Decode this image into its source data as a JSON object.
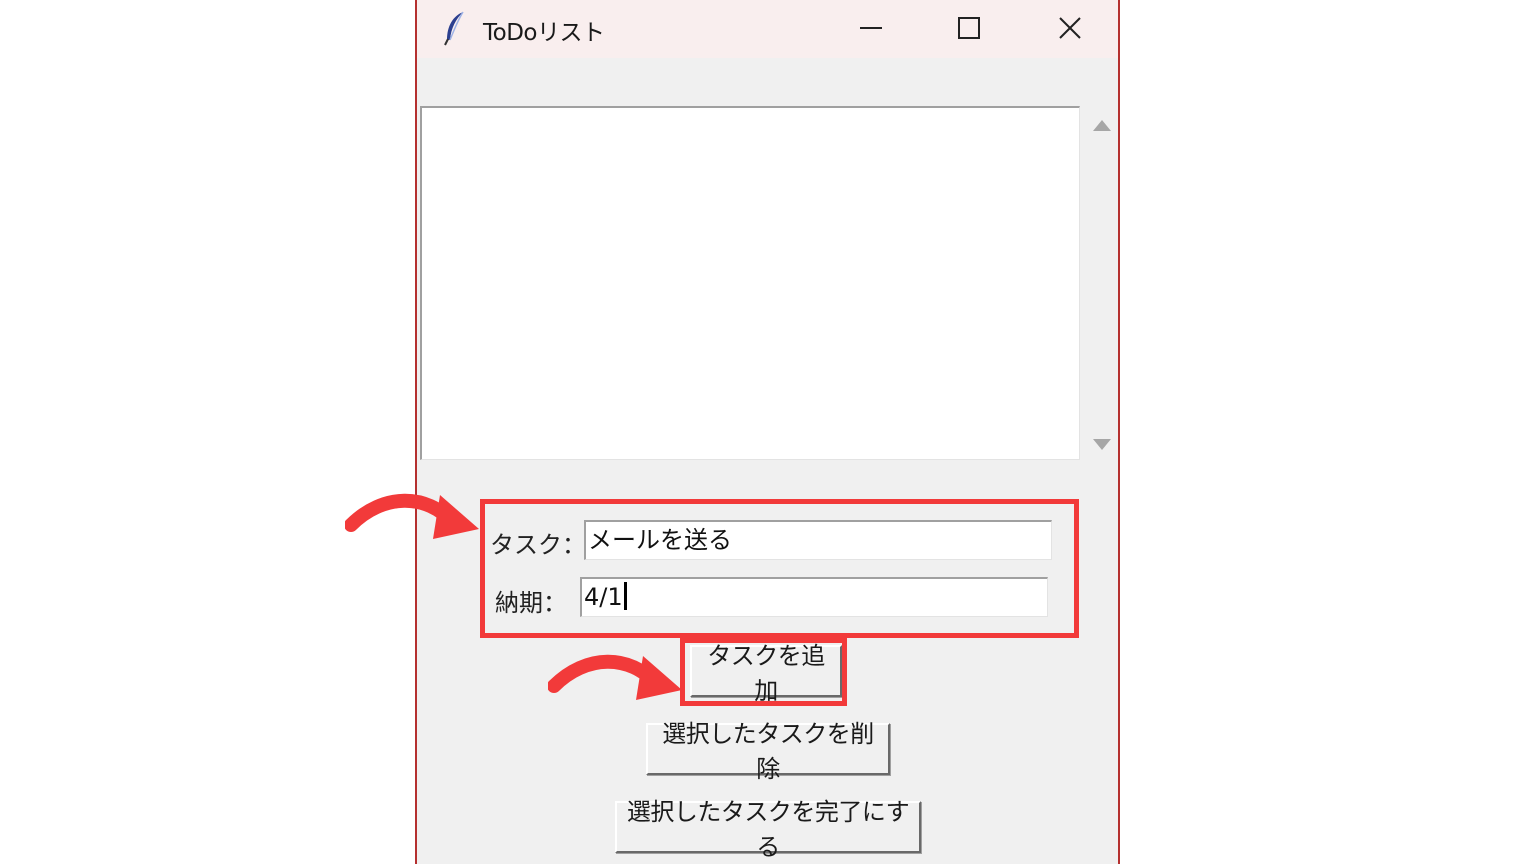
{
  "window": {
    "title": "ToDoリスト"
  },
  "form": {
    "task_label": "タスク：",
    "task_value": "メールを送る",
    "due_label": "納期：",
    "due_value": "4/1"
  },
  "buttons": {
    "add": "タスクを追加",
    "delete": "選択したタスクを削除",
    "complete": "選択したタスクを完了にする"
  },
  "icons": {
    "app": "feather-icon",
    "minimize": "minimize-icon",
    "maximize": "maximize-icon",
    "close": "close-icon",
    "scroll_up": "triangle-up-icon",
    "scroll_down": "triangle-down-icon",
    "annotation": "curved-arrow-icon"
  },
  "colors": {
    "highlight": "#f23a3a",
    "window_border": "#b5302f",
    "titlebar_bg": "#f9eeee",
    "window_bg": "#f0f0f0"
  }
}
